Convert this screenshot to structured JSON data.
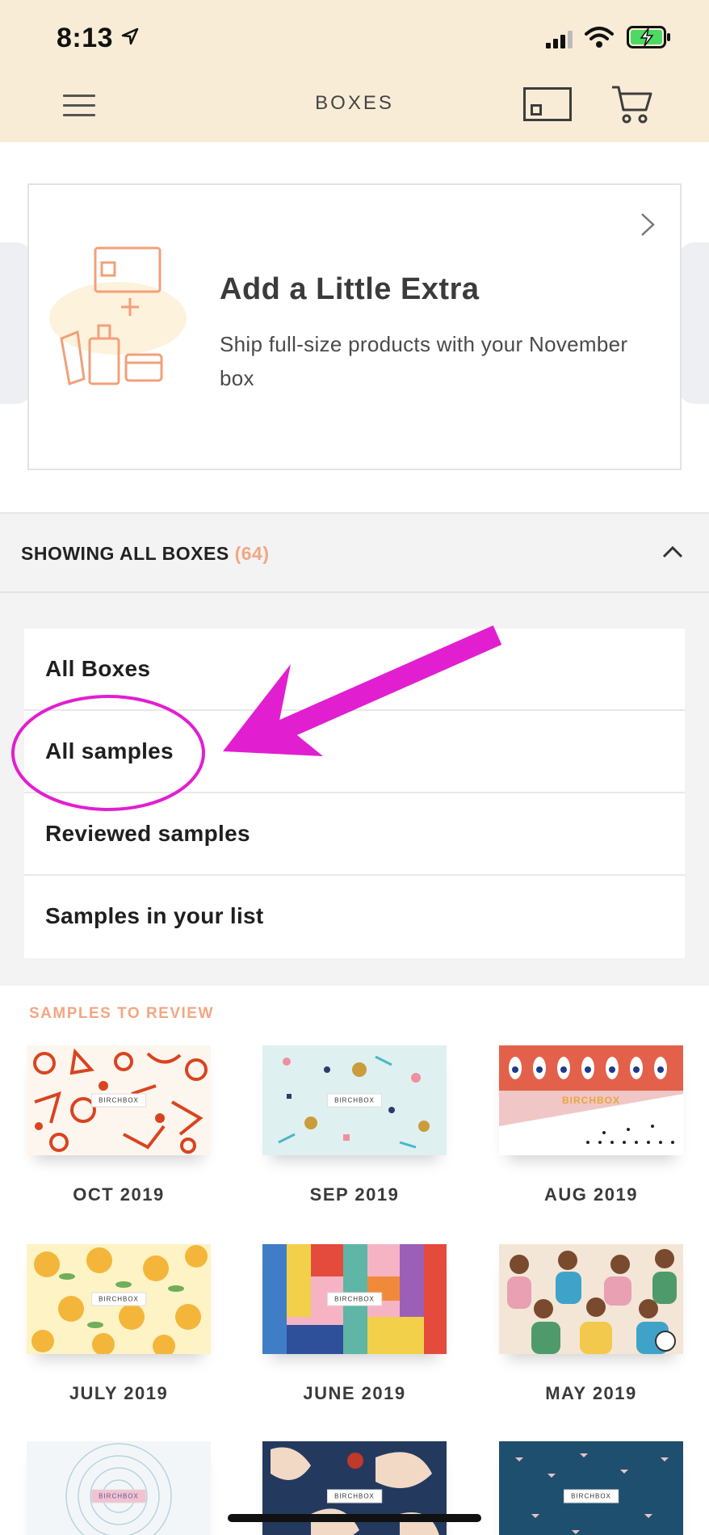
{
  "status_bar": {
    "time": "8:13"
  },
  "header": {
    "title": "BOXES"
  },
  "promo": {
    "title": "Add a Little Extra",
    "subtitle": "Ship full-size products with your November box"
  },
  "filter": {
    "label": "SHOWING ALL BOXES",
    "count": "(64)",
    "options": [
      "All Boxes",
      "All samples",
      "Reviewed samples",
      "Samples in your list"
    ]
  },
  "samples": {
    "heading": "SAMPLES TO REVIEW",
    "tiles": [
      {
        "label": "OCT 2019",
        "brand": "BIRCHBOX"
      },
      {
        "label": "SEP 2019",
        "brand": "BIRCHBOX"
      },
      {
        "label": "AUG 2019",
        "brand": "BIRCHBOX"
      },
      {
        "label": "JULY 2019",
        "brand": "BIRCHBOX"
      },
      {
        "label": "JUNE 2019",
        "brand": "BIRCHBOX"
      },
      {
        "label": "MAY 2019",
        "brand": ""
      },
      {
        "label": "",
        "brand": "BIRCHBOX"
      },
      {
        "label": "",
        "brand": "BIRCHBOX"
      },
      {
        "label": "",
        "brand": "BIRCHBOX"
      }
    ]
  },
  "colors": {
    "header_bg": "#f9ecd6",
    "accent": "#f3a682",
    "annotation": "#e11fd0"
  }
}
